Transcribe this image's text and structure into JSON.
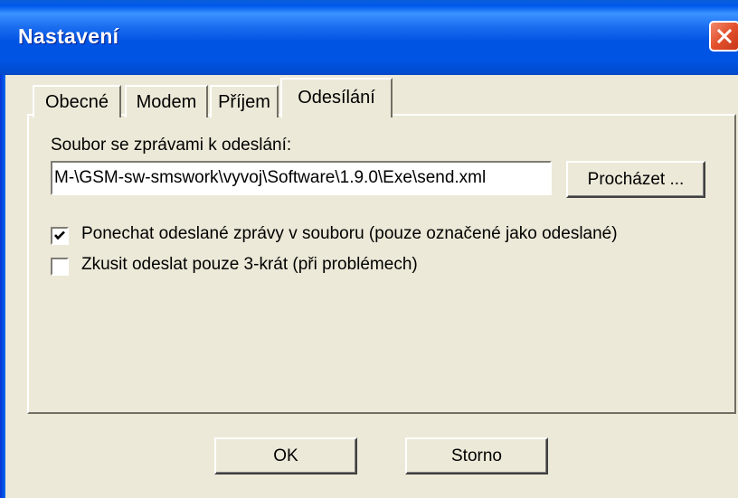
{
  "window": {
    "title": "Nastavení"
  },
  "tabs": [
    {
      "label": "Obecné",
      "selected": false
    },
    {
      "label": "Modem",
      "selected": false
    },
    {
      "label": "Příjem",
      "selected": false
    },
    {
      "label": "Odesílání",
      "selected": true
    }
  ],
  "send_tab": {
    "file_label": "Soubor se zprávami k odeslání:",
    "file_value": "M-\\GSM-sw-smswork\\vyvoj\\Software\\1.9.0\\Exe\\send.xml",
    "browse_label": "Procházet ...",
    "options": [
      {
        "label": "Ponechat odeslané zprávy v souboru (pouze označené jako odeslané)",
        "checked": true
      },
      {
        "label": "Zkusit odeslat pouze 3-krát (při problémech)",
        "checked": false
      }
    ]
  },
  "buttons": {
    "ok": "OK",
    "cancel": "Storno"
  },
  "icons": {
    "close": "close-icon",
    "check": "checkmark-icon"
  },
  "colors": {
    "titlebar": "#0054e3",
    "dialog_bg": "#ece9d8",
    "close": "#e2512c"
  }
}
